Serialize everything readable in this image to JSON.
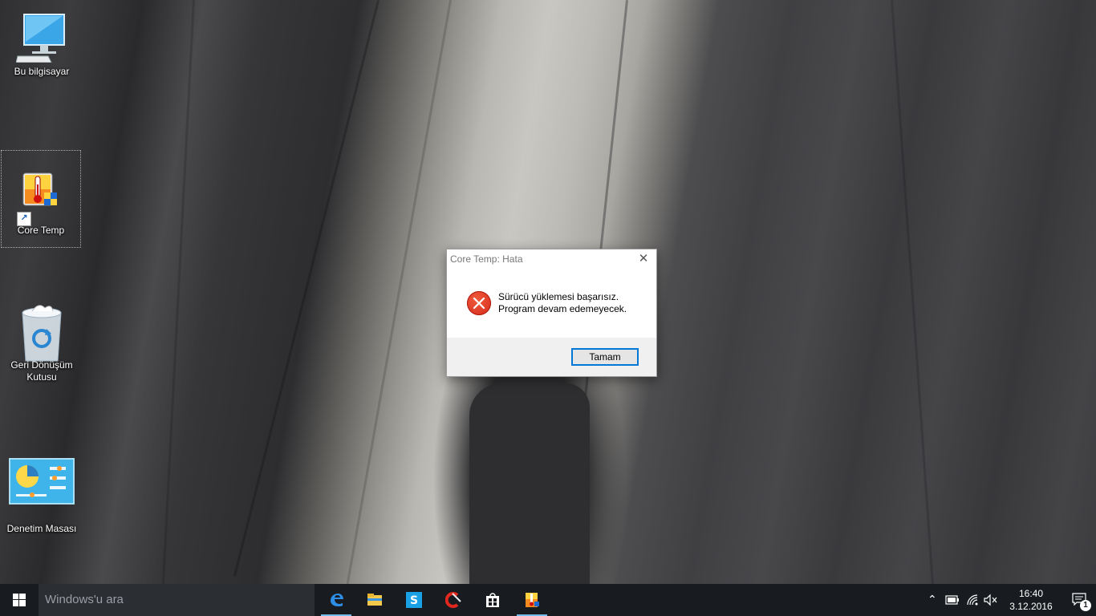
{
  "desktop": {
    "icons": [
      {
        "label": "Bu bilgisayar"
      },
      {
        "label": "Core Temp"
      },
      {
        "label": "Geri Dönüşüm Kutusu"
      },
      {
        "label": "Denetim Masası"
      }
    ]
  },
  "dialog": {
    "title": "Core Temp: Hata",
    "close_glyph": "✕",
    "icon": "error-icon",
    "message_line1": "Sürücü yüklemesi başarısız.",
    "message_line2": "Program devam edemeyecek.",
    "ok_label": "Tamam"
  },
  "taskbar": {
    "search_placeholder": "Windows'u ara",
    "apps": [
      {
        "name": "edge-icon",
        "active": true
      },
      {
        "name": "file-explorer-icon",
        "active": false
      },
      {
        "name": "skype-icon",
        "active": false
      },
      {
        "name": "ccleaner-icon",
        "active": false
      },
      {
        "name": "store-icon",
        "active": false
      },
      {
        "name": "core-temp-icon",
        "active": true
      }
    ],
    "tray": {
      "time": "16:40",
      "date": "3.12.2016",
      "notification_count": "1"
    },
    "accent": "#76b9ed"
  }
}
